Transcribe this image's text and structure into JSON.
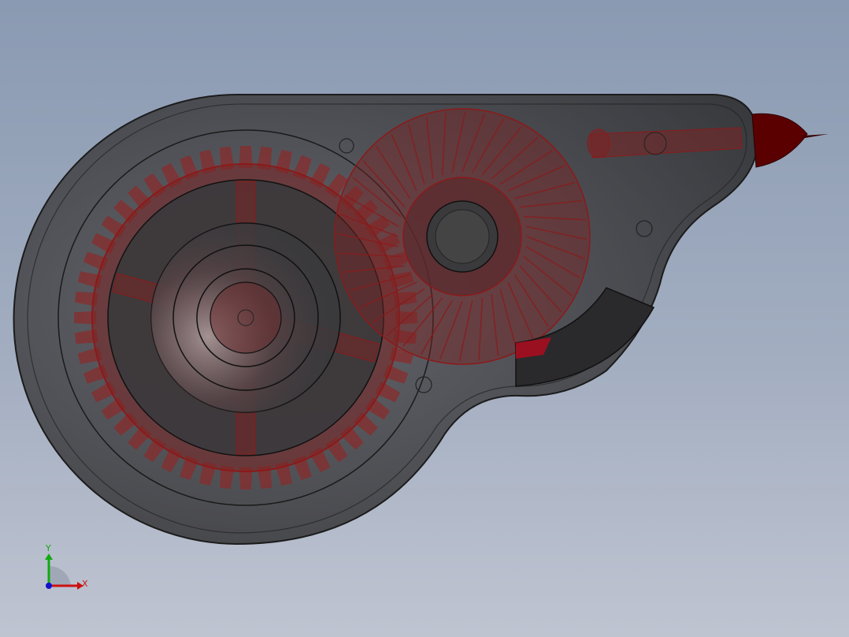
{
  "viewport": {
    "background_top": "#8a9ab2",
    "background_bottom": "#bfc4d1"
  },
  "model": {
    "body_color": "#3a3a3c",
    "part_color": "#8b1a1a",
    "tip_color": "#5a0000",
    "edge_color": "#1a1a1a"
  },
  "triad": {
    "x_label": "X",
    "y_label": "Y",
    "x_color": "#cc1111",
    "y_color": "#11aa11",
    "z_color": "#1111cc"
  }
}
